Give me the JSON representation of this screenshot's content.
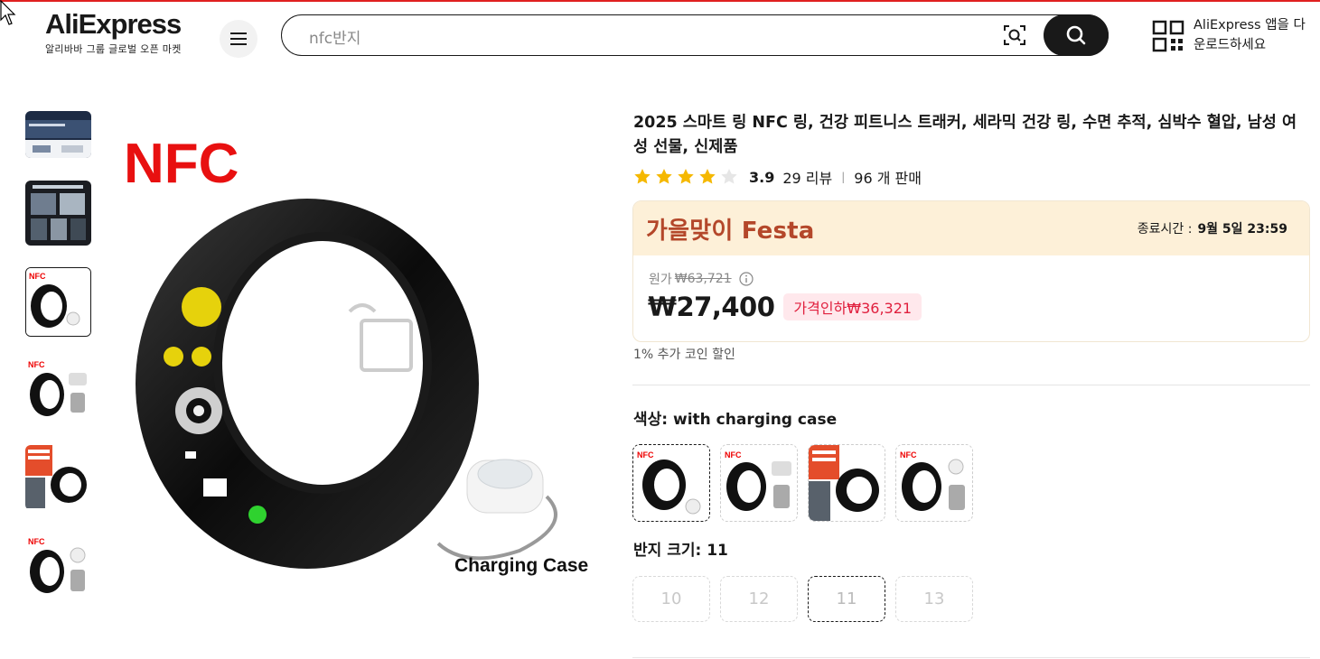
{
  "header": {
    "logo": "AliExpress",
    "logo_sub": "알리바바 그룹 글로벌 오픈 마켓",
    "search_value": "nfc반지",
    "app_download_line1": "AliExpress 앱을 다",
    "app_download_line2": "운로드하세요"
  },
  "product": {
    "title": "2025 스마트 링 NFC 링, 건강 피트니스 트래커, 세라믹 건강 링, 수면 추적, 심박수 혈압, 남성 여성 선물, 신제품",
    "rating": "3.9",
    "stars_filled": 4,
    "reviews": "29 리뷰",
    "sold": "96 개 판매",
    "main_image_label": "NFC",
    "case_label": "Charging Case"
  },
  "promo": {
    "name": "가을맞이 Festa",
    "ends_label": "종료시간 :",
    "ends_time": "9월 5일 23:59",
    "orig_label": "원가",
    "orig_price": "₩63,721",
    "price": "₩27,400",
    "discount": "가격인하₩36,321"
  },
  "coin_note": "1% 추가 코인 할인",
  "options": {
    "color_label": "색상: with charging case",
    "size_label": "반지 크기: 11",
    "sizes": [
      "10",
      "12",
      "11",
      "13"
    ]
  },
  "colors": {
    "accent": "#e02020",
    "festa": "#b4472a",
    "discount": "#e0203e"
  }
}
